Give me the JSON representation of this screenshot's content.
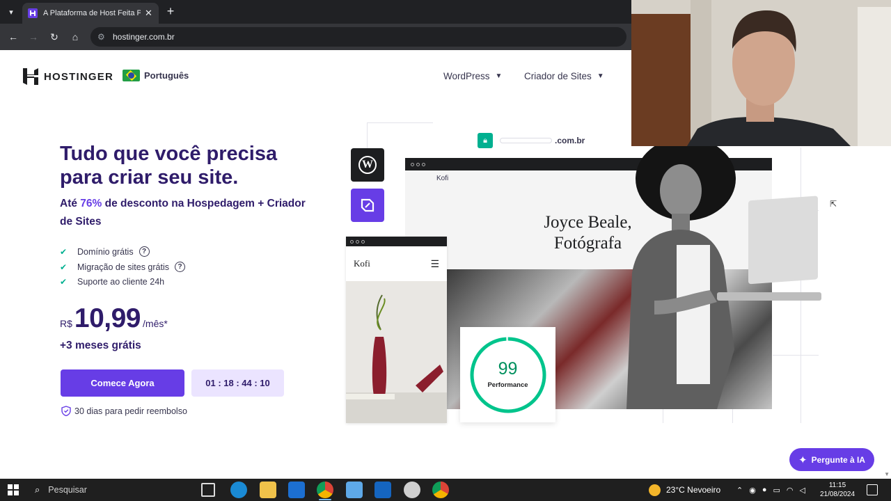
{
  "browser": {
    "tab_title": "A Plataforma de Host Feita Para",
    "tab_close": "✕",
    "new_tab": "+",
    "url": "hostinger.com.br"
  },
  "header": {
    "logo_text": "HOSTINGER",
    "language": "Português",
    "nav": [
      {
        "label": "WordPress"
      },
      {
        "label": "Criador de Sites"
      }
    ]
  },
  "hero": {
    "title": "Tudo que você precisa para criar seu site.",
    "subtitle_pre": "Até ",
    "subtitle_highlight": "76%",
    "subtitle_post": " de desconto na Hospedagem + Criador de Sites",
    "features": [
      {
        "label": "Domínio grátis",
        "help": true
      },
      {
        "label": "Migração de sites grátis",
        "help": true
      },
      {
        "label": "Suporte ao cliente 24h",
        "help": false
      }
    ],
    "currency": "R$",
    "price": "10,99",
    "period": "/mês*",
    "bonus": "+3 meses grátis",
    "cta_label": "Comece Agora",
    "timer": "01 : 18 : 44 : 10",
    "refund": "30 dias para pedir reembolso"
  },
  "illustration": {
    "domain_suffix": ".com.br",
    "desktop_brand": "Kofi",
    "desktop_name": "Joyce Beale, Fotógrafa",
    "mobile_brand": "Kofi",
    "performance_score": "99",
    "performance_label": "Performance"
  },
  "ai_button": "Pergunte à IA",
  "taskbar": {
    "search_placeholder": "Pesquisar",
    "weather": "23°C  Nevoeiro",
    "time": "11:15",
    "date": "21/08/2024"
  },
  "colors": {
    "brand_purple": "#673de6",
    "heading_navy": "#2f1c6a",
    "success_green": "#00b090"
  }
}
